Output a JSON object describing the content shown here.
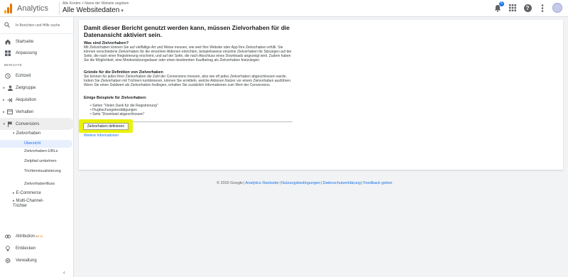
{
  "header": {
    "app_title": "Analytics",
    "account_path": "Alle Konten > Name der Website angeben",
    "view_name": "Alle Websitedaten",
    "notification_count": "5"
  },
  "sidebar": {
    "search_placeholder": "In Berichten und Hilfe suche",
    "home": "Startseite",
    "customization": "Anpassung",
    "reports_label": "BERICHTE",
    "realtime": "Echtzeit",
    "audience": "Zielgruppe",
    "acquisition": "Akquisition",
    "behavior": "Verhalten",
    "conversions": "Conversions",
    "goals": "Zielvorhaben",
    "goals_children": [
      "Übersicht",
      "Zielvorhaben-URLs",
      "Zielpfad umkehren",
      "Trichtervisualisierung",
      "Zielvorhabenfluss"
    ],
    "ecommerce": "E-Commerce",
    "multichannel": "Multi-Channel-Trichter",
    "attribution": "Attribution",
    "attribution_badge": "BETA",
    "discover": "Entdecken",
    "admin": "Verwaltung"
  },
  "main": {
    "title": "Damit dieser Bericht genutzt werden kann, müssen Zielvorhaben für die Datenansicht aktiviert sein.",
    "what_heading": "Was sind Zielvorhaben?",
    "what_text": "Mit Zielvorhaben können Sie auf vielfältige Art und Weise messen, wie weit Ihre Website oder App Ihre Zielvorhaben erfüllt. Sie können verschiedene Zielvorhaben für die einzelnen Aktionen einrichten, beispielsweise einzelne Zielvorhaben für Sitzungen auf der Seite, die nach einer Registrierung erscheint, und auf der Seite, die nach Abschluss eines Downloads angezeigt wird. Zudem haben Sie die Möglichkeit, eine Mindestsitzungsdauer oder einen bestimmten Kaufbetrag als Zielvorhaben festzulegen.",
    "why_heading": "Gründe für die Definition von Zielvorhaben",
    "why_text": "Sie können für jedes Ihrer Zielvorhaben die Zahl der Conversions messen, also wie oft jedes Zielvorhaben abgeschlossen wurde. Indem Sie Zielvorhaben mit Trichtern kombinieren, können Sie ermitteln, welche Aktionen Nutzer vor einem Zielvorhaben ausführen. Wenn Sie einen Geldwert als Zielvorhaben festlegen, erhalten Sie zusätzlich Informationen zum Wert der Conversions.",
    "examples_heading": "Einige Beispiele für Zielvorhaben:",
    "examples": [
      "Seiten \"Vielen Dank für die Registrierung\"",
      "Flugbuchungsbestätigungen",
      "Seite \"Download abgeschlossen\""
    ],
    "define_button": "Zielvorhaben definieren",
    "more_info": "Weitere Informationen"
  },
  "footer": {
    "copyright": "© 2020 Google",
    "links": [
      "Analytics-Startseite",
      "Nutzungsbedingungen",
      "Datenschutzerklärung",
      "Feedback geben"
    ]
  }
}
